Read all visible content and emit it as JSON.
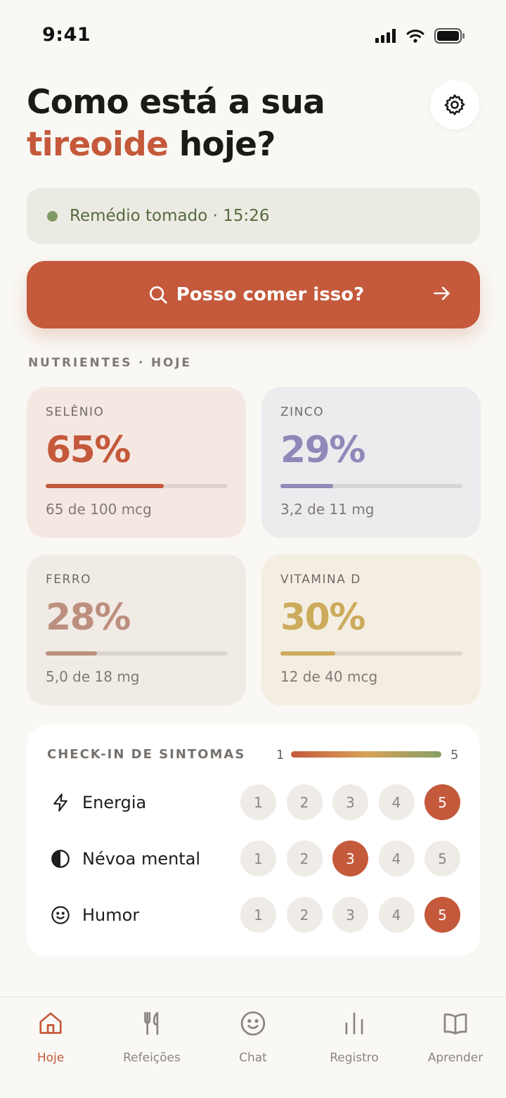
{
  "status_bar": {
    "time": "9:41"
  },
  "header": {
    "line1": "Como está a sua",
    "accent": "tireoide",
    "line2_rest": " hoje?"
  },
  "medication": {
    "text": "Remédio tomado · 15:26",
    "status_color": "#7f9a63"
  },
  "search_cta": {
    "label": "Posso comer isso?"
  },
  "nutrients": {
    "section_label": "NUTRIENTES · HOJE",
    "items": [
      {
        "name": "SELÊNIO",
        "percent_label": "65%",
        "percent": 65,
        "amount": "65 de 100 mcg",
        "color": "#c4593b",
        "bg": "#f5e8e3"
      },
      {
        "name": "ZINCO",
        "percent_label": "29%",
        "percent": 29,
        "amount": "3,2 de 11 mg",
        "color": "#9187b8",
        "bg": "#ecebee"
      },
      {
        "name": "FERRO",
        "percent_label": "28%",
        "percent": 28,
        "amount": "5,0 de 18 mg",
        "color": "#bd8f7e",
        "bg": "#f1ebe6"
      },
      {
        "name": "VITAMINA D",
        "percent_label": "30%",
        "percent": 30,
        "amount": "12 de 40 mcg",
        "color": "#ccab5c",
        "bg": "#f4eee2"
      }
    ]
  },
  "symptoms": {
    "title": "CHECK-IN DE SINTOMAS",
    "scale_min": "1",
    "scale_max": "5",
    "rating_options": [
      "1",
      "2",
      "3",
      "4",
      "5"
    ],
    "rows": [
      {
        "label": "Energia",
        "icon": "lightning-icon",
        "selected": 5
      },
      {
        "label": "Névoa mental",
        "icon": "half-circle-icon",
        "selected": 3
      },
      {
        "label": "Humor",
        "icon": "smiley-icon",
        "selected": 5
      }
    ]
  },
  "tabs": [
    {
      "label": "Hoje",
      "icon": "home-icon",
      "active": true
    },
    {
      "label": "Refeições",
      "icon": "utensils-icon",
      "active": false
    },
    {
      "label": "Chat",
      "icon": "smiley-icon",
      "active": false
    },
    {
      "label": "Registro",
      "icon": "bar-chart-icon",
      "active": false
    },
    {
      "label": "Aprender",
      "icon": "book-icon",
      "active": false
    }
  ],
  "colors": {
    "accent": "#c4593b",
    "background": "#f9f8f4",
    "inactive": "#8a8580"
  }
}
